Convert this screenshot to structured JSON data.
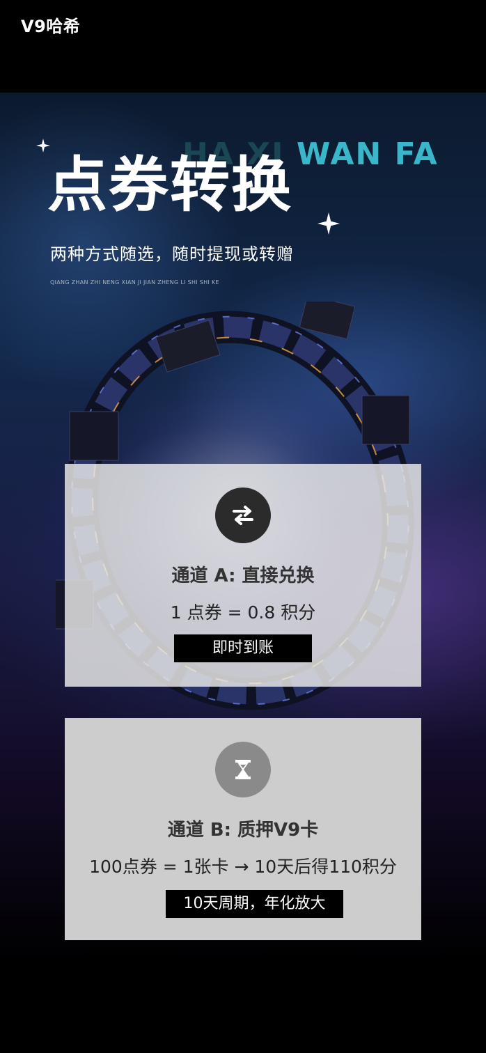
{
  "app": {
    "title": "V9哈希"
  },
  "hero": {
    "watermark_dim": "HA XI ",
    "watermark_bright": "WAN FA",
    "title": "点券转换",
    "subtitle": "两种方式随选，随时提现或转赠",
    "pinyin": "QIANG ZHAN ZHI NENG XIAN JI JIAN ZHENG LI SHI SHI KE"
  },
  "channels": [
    {
      "icon": "swap-arrows-icon",
      "title": "通道 A: 直接兑换",
      "rate": "1 点券 = 0.8 积分",
      "tag": "即时到账"
    },
    {
      "icon": "hourglass-icon",
      "title": "通道 B: 质押V9卡",
      "rate": "100点券 = 1张卡 → 10天后得110积分",
      "tag": "10天周期，年化放大"
    }
  ],
  "colors": {
    "page_bg": "#000000",
    "watermark": "#3ec3d8",
    "badge_a": "#2b2b2b",
    "badge_b": "#8a8a8a",
    "pill_bg": "#000000"
  }
}
